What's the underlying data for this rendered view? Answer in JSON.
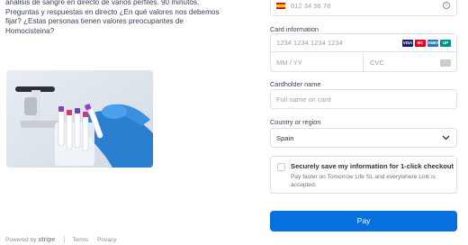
{
  "product": {
    "description": "análisis de sangre en directo de varios perfiles. 90 minutos. Preguntas y respuestas en directo ¿En qué valores nos debemos fijar? ¿Estas personas tienen valores preocupantes de Homocisteina?"
  },
  "footer": {
    "powered_by": "Powered by",
    "brand": "stripe",
    "terms": "Terms",
    "privacy": "Privacy"
  },
  "phone": {
    "value": "612 34 56 78",
    "flag": "spain-flag"
  },
  "card": {
    "label": "Card information",
    "number_placeholder": "1234 1234 1234 1234",
    "expiry_placeholder": "MM / YY",
    "cvc_placeholder": "CVC",
    "brands": [
      "VISA",
      "MC",
      "AMEX",
      "UP"
    ]
  },
  "cardholder": {
    "label": "Cardholder name",
    "placeholder": "Full name on card"
  },
  "country": {
    "label": "Country or region",
    "selected": "Spain"
  },
  "link_save": {
    "title": "Securely save my information for 1-click checkout",
    "subtitle": "Pay faster on Tomorrow Life SL and everywhere Link is accepted."
  },
  "pay_button": {
    "label": "Pay"
  },
  "colors": {
    "primary": "#0570de",
    "border": "#e0e2e7",
    "text": "#30313d"
  }
}
